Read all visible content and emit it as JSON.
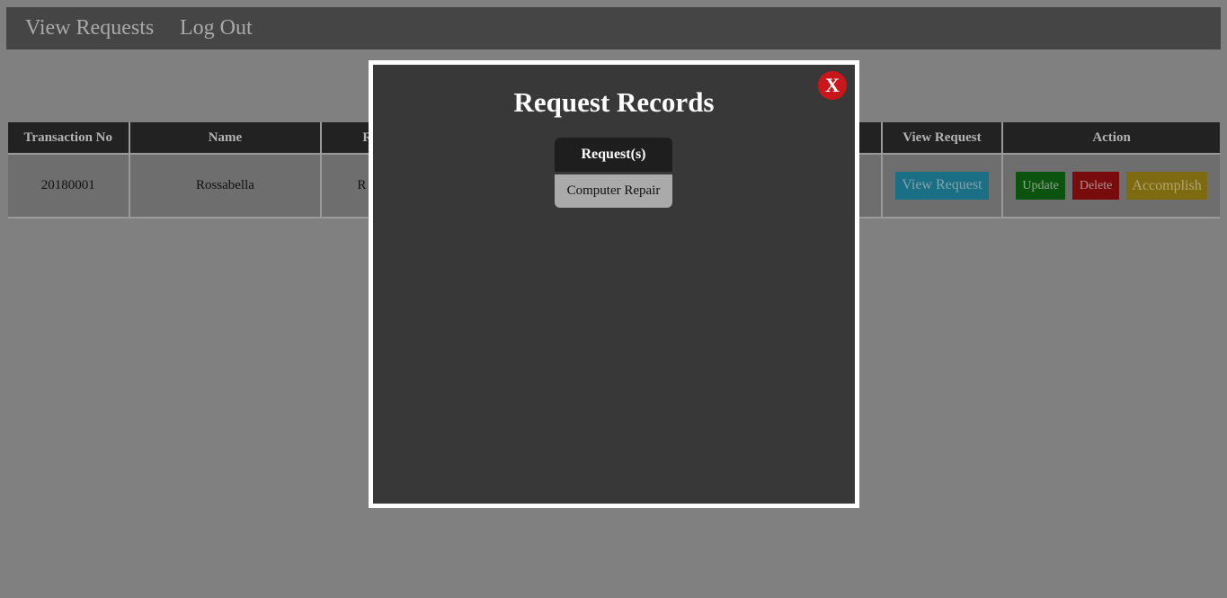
{
  "nav": {
    "view_requests": "View Requests",
    "log_out": "Log Out"
  },
  "table": {
    "headers": [
      "Transaction No",
      "Name",
      "R",
      "",
      "",
      "",
      "View Request",
      "Action"
    ],
    "rows": [
      {
        "transaction_no": "20180001",
        "name": "Rossabella",
        "col3": "R",
        "view_request_label": "View Request",
        "update_label": "Update",
        "delete_label": "Delete",
        "accomplish_label": "Accomplish"
      }
    ]
  },
  "modal": {
    "title": "Request Records",
    "close_label": "X",
    "requests_header": "Request(s)",
    "requests": [
      "Computer Repair"
    ]
  },
  "colors": {
    "overlay_background": "#808080",
    "modal_background": "#383838",
    "close_button": "#c8161b",
    "view_button": "#1b6f85",
    "update_button": "#0d5310",
    "delete_button": "#780c0c",
    "accomplish_button": "#7e6a10"
  }
}
